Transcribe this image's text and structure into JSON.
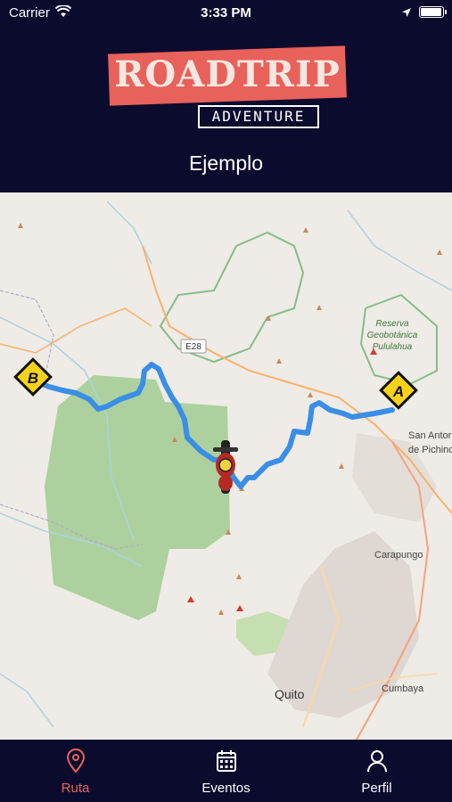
{
  "status_bar": {
    "carrier": "Carrier",
    "time": "3:33 PM",
    "battery_level": 1.0
  },
  "header": {
    "logo_title": "ROADTRIP",
    "logo_subtitle": "ADVENTURE",
    "title": "Ejemplo"
  },
  "map": {
    "labels": {
      "road": "E28",
      "reserve_line1": "Reserva",
      "reserve_line2": "Geobotánica",
      "reserve_line3": "Pululahua",
      "san_antonio_line1": "San Antor",
      "san_antonio_line2": "de Pichinc",
      "carapungo": "Carapungo",
      "quito": "Quito",
      "cumbaya": "Cumbaya"
    },
    "markers": {
      "start": "A",
      "end": "B"
    },
    "colors": {
      "route": "#3a8ee6",
      "forest": "#add19e",
      "marker_fill": "#f7d21a"
    }
  },
  "tabs": [
    {
      "label": "Ruta",
      "icon": "map-pin-icon",
      "active": true
    },
    {
      "label": "Eventos",
      "icon": "calendar-icon",
      "active": false
    },
    {
      "label": "Perfil",
      "icon": "user-icon",
      "active": false
    }
  ],
  "colors": {
    "background": "#0b0b2e",
    "accent": "#e8615a"
  }
}
